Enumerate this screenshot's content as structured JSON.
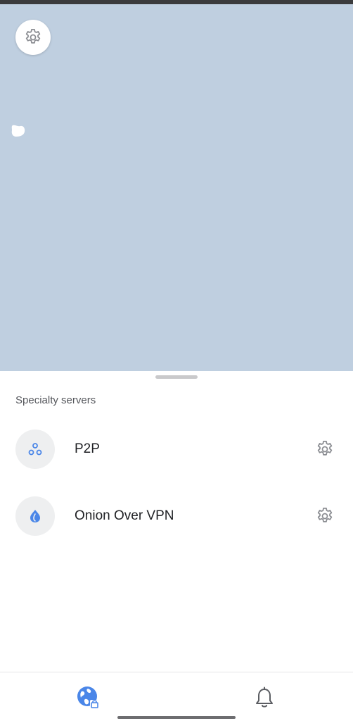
{
  "sheet": {
    "title": "Specialty servers",
    "servers": [
      {
        "label": "P2P",
        "icon": "p2p-icon"
      },
      {
        "label": "Onion Over VPN",
        "icon": "onion-icon"
      }
    ]
  },
  "nav": {
    "items": [
      {
        "icon": "globe-lock-icon",
        "active": true
      },
      {
        "icon": "bell-icon",
        "active": false
      }
    ]
  },
  "colors": {
    "accent": "#4a86e8",
    "map_water": "#bfcfe0",
    "icon_gray": "#8b8d92"
  }
}
